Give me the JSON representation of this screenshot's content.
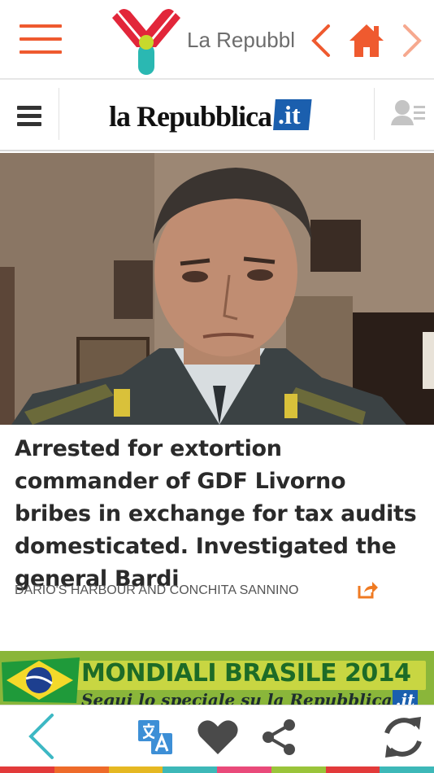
{
  "app_bar": {
    "title": "La Repubbl",
    "menu_icon": "hamburger-icon",
    "logo_icon": "y-logo-icon",
    "back_icon": "chevron-left-icon",
    "home_icon": "home-icon",
    "forward_icon": "chevron-right-icon",
    "accent_color": "#ef5a2f"
  },
  "site_header": {
    "logo_word": "la Repubblica",
    "logo_suffix": ".it",
    "menu_icon": "hamburger-icon",
    "user_icon": "user-list-icon"
  },
  "article": {
    "headline": "Arrested for extortion commander of GDF Livorno bribes in exchange for tax audits domesticated. Investigated the general Bardi",
    "byline": "DARIO'S HARBOUR AND CONCHITA SANNINO",
    "share_icon": "share-arrow-icon"
  },
  "banner": {
    "title": "MONDIALI BRASILE 2014",
    "subtitle_prefix": "Segui lo speciale su ",
    "subtitle_brand": "la Repubblica",
    "subtitle_suffix": ".it"
  },
  "toolbar": {
    "back_icon": "chevron-left-icon",
    "translate_icon": "translate-icon",
    "favorite_icon": "heart-icon",
    "share_icon": "share-icon",
    "refresh_icon": "refresh-icon"
  },
  "stripe_colors": [
    "#e23a3a",
    "#ee6b2a",
    "#e5b822",
    "#3db8b8",
    "#e94a7a",
    "#9ac43a",
    "#e23a3a",
    "#3db8b8"
  ]
}
